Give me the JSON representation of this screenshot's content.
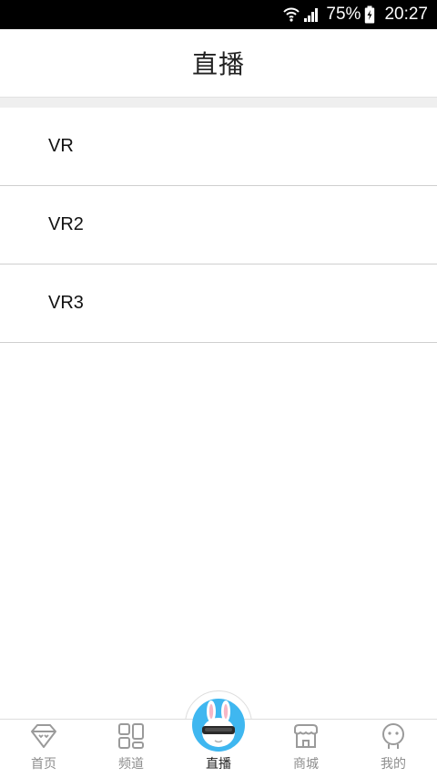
{
  "status_bar": {
    "battery_percent": "75%",
    "time": "20:27",
    "icons": [
      "wifi-icon",
      "signal-icon",
      "battery-charging-icon"
    ]
  },
  "header": {
    "title": "直播"
  },
  "list": {
    "items": [
      {
        "label": "VR"
      },
      {
        "label": "VR2"
      },
      {
        "label": "VR3"
      }
    ]
  },
  "tabbar": {
    "tabs": [
      {
        "label": "首页",
        "icon": "diamond-face-icon",
        "active": false
      },
      {
        "label": "频道",
        "icon": "grid-icon",
        "active": false
      },
      {
        "label": "直播",
        "icon": "vr-rabbit-avatar-icon",
        "active": true
      },
      {
        "label": "商城",
        "icon": "shop-icon",
        "active": false
      },
      {
        "label": "我的",
        "icon": "profile-face-icon",
        "active": false
      }
    ]
  },
  "colors": {
    "accent": "#3fb7f0",
    "inactive_tab": "#8e8e8e",
    "active_tab": "#222222",
    "separator": "#efefef"
  }
}
